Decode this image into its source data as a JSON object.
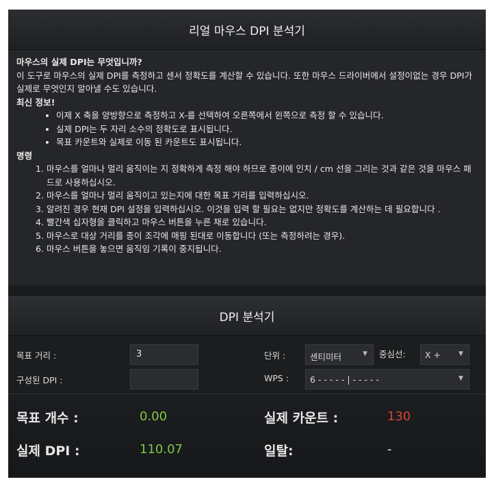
{
  "header": {
    "title": "리얼 마우스 DPI 분석기"
  },
  "info": {
    "question": "마우스의 실제 DPI는 무엇입니까?",
    "intro": "이 도구로 마우스의 실제 DPI를 측정하고 센서 정확도를 계산할 수 있습니다. 또한 마우스 드라이버에서 설정이없는 경우 DPI가 실제로 무엇인지 알아낼 수도 있습니다.",
    "latest_heading": "최신 정보!",
    "latest": [
      "이제 X 축을 양방향으로 측정하고 X-를 선택하여 오른쪽에서 왼쪽으로 측정 할 수 있습니다.",
      "실제 DPI는 두 자리 소수의 정확도로 표시됩니다.",
      "목표 카운트와 실제로 이동 된 카운트도 표시됩니다."
    ],
    "commands_heading": "명령",
    "commands": [
      "마우스를 얼마나 멀리 움직이는 지 정확하게 측정 해야 하므로 종이에 인치 / cm 선을 그리는 것과 같은 것을 마우스 패드로 사용하십시오.",
      "마우스를 얼마나 멀리 움직이고 있는지에 대한 목표 거리를 입력하십시오.",
      "알려진 경우 현재 DPI 설정을 입력하십시오. 이것을 입력 할 필요는 없지만 정확도를 계산하는 데 필요합니다 .",
      "빨간색 십자형을 클릭하고 마우스 버튼을 누른 채로 있습니다.",
      "마우스로 대상 거리를 종이 조각에 매핑 된대로 이동합니다 (또는 측정하려는 경우).",
      "마우스 버튼을 놓으면 움직임 기록이 중지됩니다."
    ]
  },
  "analyzer": {
    "title": "DPI 분석기",
    "target_distance_label": "목표 거리 :",
    "target_distance_value": "3",
    "configured_dpi_label": "구성된 DPI :",
    "configured_dpi_value": "",
    "unit_label": "단위 :",
    "unit_value": "센티미터",
    "axis_label": "중심선:",
    "axis_value": "X +",
    "wps_label": "WPS :",
    "wps_value": "6 - - - - - | - - - - -"
  },
  "results": {
    "target_count_label": "목표 개수 :",
    "target_count_value": "0.00",
    "actual_count_label": "실제 카운트 :",
    "actual_count_value": "130",
    "actual_dpi_label": "실제 DPI :",
    "actual_dpi_value": "110.07",
    "deviation_label": "일탈:",
    "deviation_value": "-"
  },
  "colors": {
    "green": "#7fc846",
    "red": "#d64533",
    "panel": "#252629"
  }
}
